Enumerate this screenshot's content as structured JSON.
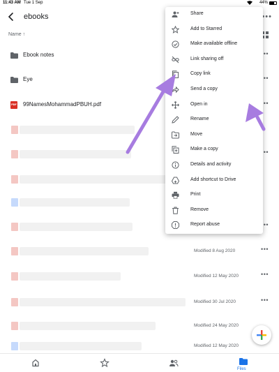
{
  "status_bar": {
    "time": "11:43 AM",
    "date": "Tue 1 Sep",
    "battery": "44%"
  },
  "app_bar": {
    "title": "ebooks"
  },
  "sort_bar": {
    "label": "Name ↑"
  },
  "files": [
    {
      "name": "Ebook notes",
      "icon": "folder-icon"
    },
    {
      "name": "Eye",
      "icon": "folder-icon"
    },
    {
      "name": "99NamesMohammadPBUH.pdf",
      "icon": "pdf-icon"
    }
  ],
  "pdf_badge": "PDF",
  "modified_dates": [
    {
      "text": "Modified 8 Aug 2020"
    },
    {
      "text": "Modified 12 May 2020"
    },
    {
      "text": "Modified 30 Jul 2020"
    },
    {
      "text": "Modified 24 May 2020"
    },
    {
      "text": "Modified 12 May 2020"
    }
  ],
  "context_menu": {
    "items": [
      {
        "label": "Share",
        "icon": "add-person-icon"
      },
      {
        "label": "Add to Starred",
        "icon": "star-icon"
      },
      {
        "label": "Make available offline",
        "icon": "offline-icon"
      },
      {
        "label": "Link sharing off",
        "icon": "link-off-icon"
      },
      {
        "label": "Copy link",
        "icon": "copy-icon"
      },
      {
        "label": "Send a copy",
        "icon": "send-icon"
      },
      {
        "label": "Open in",
        "icon": "open-in-icon"
      },
      {
        "label": "Rename",
        "icon": "pencil-icon"
      },
      {
        "label": "Move",
        "icon": "move-icon"
      },
      {
        "label": "Make a copy",
        "icon": "duplicate-icon"
      },
      {
        "label": "Details and activity",
        "icon": "info-icon"
      },
      {
        "label": "Add shortcut to Drive",
        "icon": "drive-shortcut-icon"
      },
      {
        "label": "Print",
        "icon": "print-icon"
      },
      {
        "label": "Remove",
        "icon": "trash-icon"
      },
      {
        "label": "Report abuse",
        "icon": "report-icon"
      }
    ]
  },
  "bottom_nav": {
    "files_label": "Files"
  },
  "colors": {
    "accent": "#1a73e8",
    "arrow": "#a77ce0",
    "pdf": "#d93025",
    "folder": "#5f6368"
  }
}
